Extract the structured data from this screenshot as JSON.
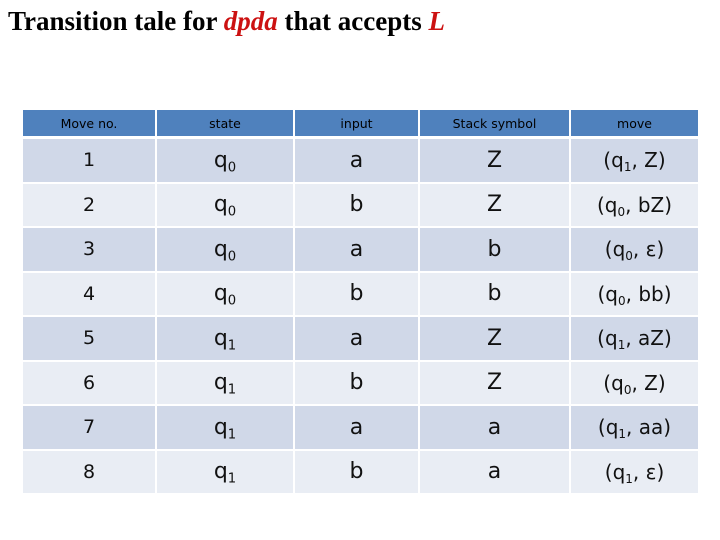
{
  "title": {
    "part1": "Transition tale for ",
    "accent1": "dpda",
    "part2": " that accepts ",
    "accent2": "L",
    "accent_color": "#cc1111"
  },
  "table": {
    "header_color": "#4f81bd",
    "row_colors": [
      "#d0d8e8",
      "#e9edf4"
    ],
    "headers": [
      "Move no.",
      "state",
      "input",
      "Stack symbol",
      "move"
    ],
    "rows": [
      {
        "no": "1",
        "state": "q",
        "state_sub": "0",
        "input": "a",
        "stack": "Z",
        "move_state": "q",
        "move_sub": "1",
        "move_push": "Z"
      },
      {
        "no": "2",
        "state": "q",
        "state_sub": "0",
        "input": "b",
        "stack": "Z",
        "move_state": "q",
        "move_sub": "0",
        "move_push": "bZ"
      },
      {
        "no": "3",
        "state": "q",
        "state_sub": "0",
        "input": "a",
        "stack": "b",
        "move_state": "q",
        "move_sub": "0",
        "move_push": "ε"
      },
      {
        "no": "4",
        "state": "q",
        "state_sub": "0",
        "input": "b",
        "stack": "b",
        "move_state": "q",
        "move_sub": "0",
        "move_push": "bb"
      },
      {
        "no": "5",
        "state": "q",
        "state_sub": "1",
        "input": "a",
        "stack": "Z",
        "move_state": "q",
        "move_sub": "1",
        "move_push": "aZ"
      },
      {
        "no": "6",
        "state": "q",
        "state_sub": "1",
        "input": "b",
        "stack": "Z",
        "move_state": "q",
        "move_sub": "0",
        "move_push": "Z"
      },
      {
        "no": "7",
        "state": "q",
        "state_sub": "1",
        "input": "a",
        "stack": "a",
        "move_state": "q",
        "move_sub": "1",
        "move_push": "aa"
      },
      {
        "no": "8",
        "state": "q",
        "state_sub": "1",
        "input": "b",
        "stack": "a",
        "move_state": "q",
        "move_sub": "1",
        "move_push": "ε"
      }
    ]
  }
}
